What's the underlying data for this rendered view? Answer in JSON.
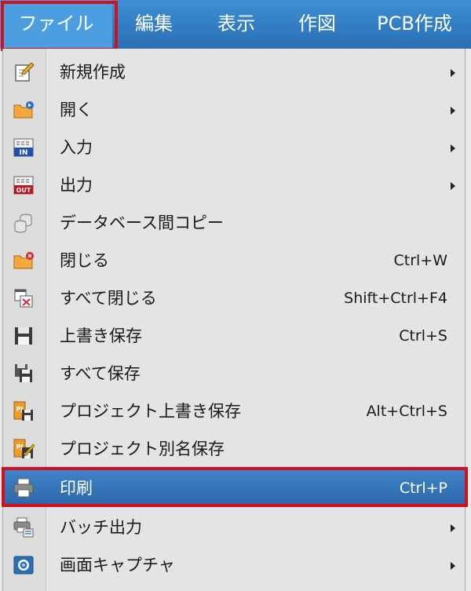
{
  "menubar": {
    "items": [
      {
        "label": "ファイル"
      },
      {
        "label": "編集"
      },
      {
        "label": "表示"
      },
      {
        "label": "作図"
      },
      {
        "label": "PCB作成"
      }
    ]
  },
  "file_menu": {
    "items": [
      {
        "label": "新規作成",
        "shortcut": "",
        "submenu": true,
        "icon": "new-icon"
      },
      {
        "label": "開く",
        "shortcut": "",
        "submenu": true,
        "icon": "open-folder-icon"
      },
      {
        "label": "入力",
        "shortcut": "",
        "submenu": true,
        "icon": "import-icon"
      },
      {
        "label": "出力",
        "shortcut": "",
        "submenu": true,
        "icon": "export-icon"
      },
      {
        "label": "データベース間コピー",
        "shortcut": "",
        "submenu": false,
        "icon": "database-copy-icon"
      },
      {
        "label": "閉じる",
        "shortcut": "Ctrl+W",
        "submenu": false,
        "icon": "close-folder-icon"
      },
      {
        "label": "すべて閉じる",
        "shortcut": "Shift+Ctrl+F4",
        "submenu": false,
        "icon": "close-all-icon"
      },
      {
        "label": "上書き保存",
        "shortcut": "Ctrl+S",
        "submenu": false,
        "icon": "save-icon"
      },
      {
        "label": "すべて保存",
        "shortcut": "",
        "submenu": false,
        "icon": "save-all-icon"
      },
      {
        "label": "プロジェクト上書き保存",
        "shortcut": "Alt+Ctrl+S",
        "submenu": false,
        "icon": "project-save-icon"
      },
      {
        "label": "プロジェクト別名保存",
        "shortcut": "",
        "submenu": false,
        "icon": "project-save-as-icon"
      },
      {
        "label": "印刷",
        "shortcut": "Ctrl+P",
        "submenu": false,
        "icon": "printer-icon",
        "selected": true
      },
      {
        "label": "バッチ出力",
        "shortcut": "",
        "submenu": true,
        "icon": "batch-output-icon"
      },
      {
        "label": "画面キャプチャ",
        "shortcut": "",
        "submenu": true,
        "icon": "camera-icon"
      }
    ]
  },
  "colors": {
    "menubar_bg": "#2a6fb3",
    "selected_bg": "#2c66a8",
    "highlight_border": "#d0101c"
  }
}
